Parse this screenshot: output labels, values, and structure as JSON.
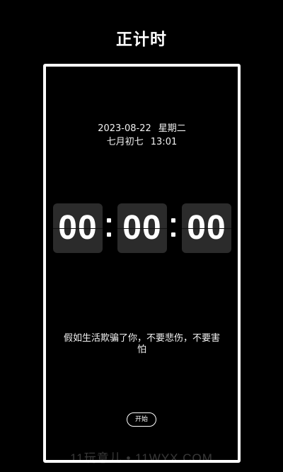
{
  "header": {
    "title": "正计时"
  },
  "clock": {
    "date": "2023-08-22",
    "weekday": "星期二",
    "lunar_date": "七月初七",
    "time": "13:01"
  },
  "timer": {
    "hours": "00",
    "minutes": "00",
    "seconds": "00"
  },
  "quote": {
    "text": "假如生活欺骗了你，不要悲伤，不要害怕"
  },
  "controls": {
    "start_label": "开始"
  },
  "watermark": {
    "text": "11玩意儿 • 11WYX.COM"
  },
  "colors": {
    "background": "#000000",
    "foreground": "#ffffff",
    "digit_box": "#2b2b2b"
  }
}
